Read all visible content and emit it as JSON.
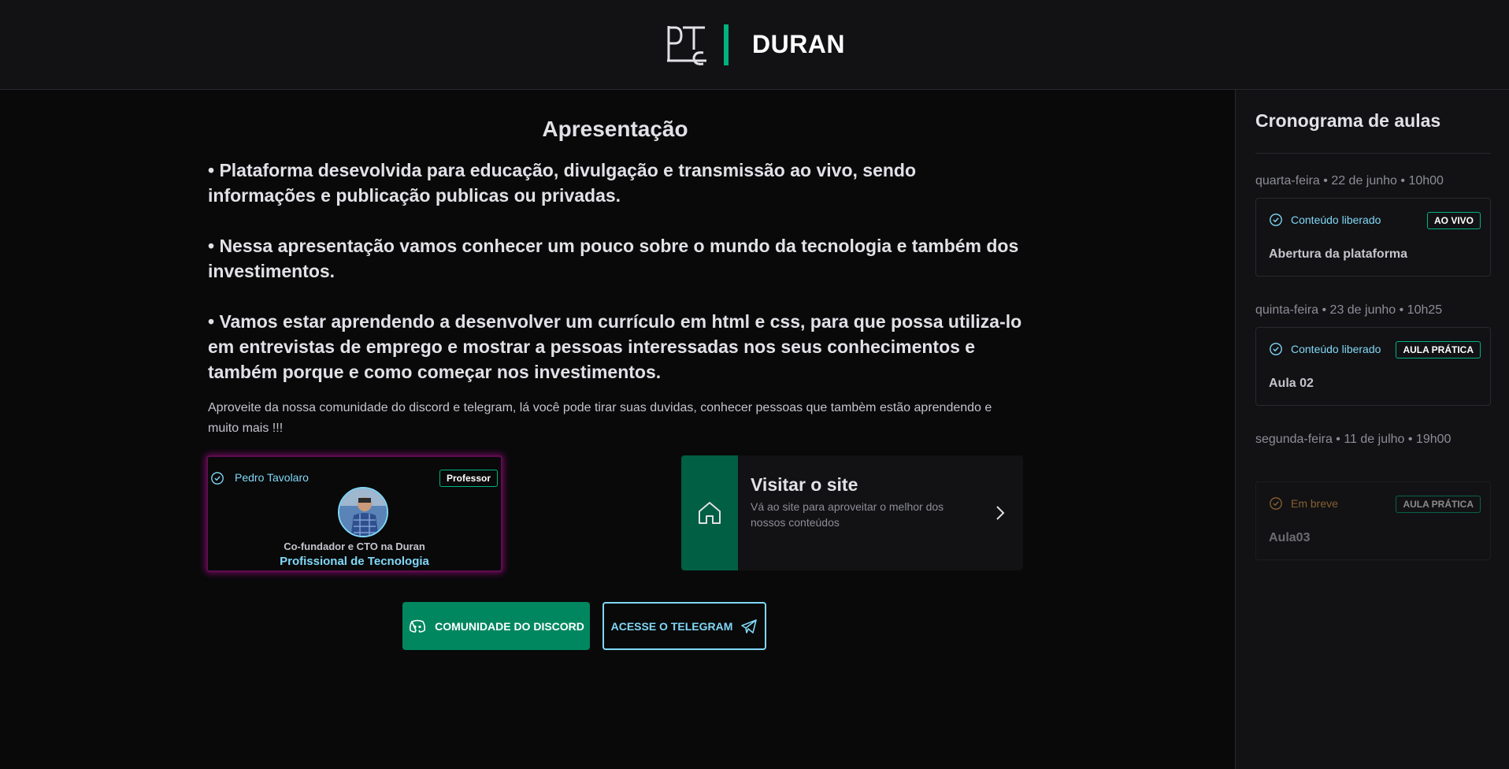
{
  "header": {
    "brand": "DURAN",
    "logo_letters": "PTC"
  },
  "main": {
    "title": "Apresentação",
    "paragraphs": [
      "• Plataforma desevolvida para educação, divulgação e transmissão ao vivo, sendo informações e publicação publicas ou privadas.",
      "• Nessa apresentação vamos conhecer um pouco sobre o mundo da tecnologia e também dos investimentos.",
      "• Vamos estar aprendendo a desenvolver um currículo em html e css, para que possa utiliza-lo em entrevistas de emprego e mostrar a pessoas interessadas nos seus conhecimentos e também porque e como começar nos investimentos."
    ],
    "note": "Aproveite da nossa comunidade do discord e telegram, lá você pode tirar suas duvidas, conhecer pessoas que tambèm estão aprendendo e muito mais !!!"
  },
  "professor": {
    "name": "Pedro Tavolaro",
    "badge": "Professor",
    "role": "Co-fundador e CTO na Duran",
    "title": "Profissional de Tecnologia"
  },
  "visit": {
    "title": "Visitar o site",
    "description": "Vá ao site para aproveitar o melhor dos nossos conteúdos"
  },
  "buttons": {
    "discord": "COMUNIDADE DO DISCORD",
    "telegram": "ACESSE O TELEGRAM"
  },
  "sidebar": {
    "title": "Cronograma de aulas",
    "lessons": [
      {
        "date": "quarta-feira • 22 de junho • 10h00",
        "status": "Conteúdo liberado",
        "badge": "AO VIVO",
        "name": "Abertura da plataforma"
      },
      {
        "date": "quinta-feira • 23 de junho • 10h25",
        "status": "Conteúdo liberado",
        "badge": "AULA PRÁTICA",
        "name": "Aula 02"
      },
      {
        "date": "segunda-feira • 11 de julho • 19h00",
        "status": "Em breve",
        "badge": "AULA PRÁTICA",
        "name": "Aula03"
      }
    ]
  },
  "colors": {
    "accent_green": "#00b37e",
    "accent_blue": "#81d8f7",
    "soon_orange": "#fba94c",
    "card_glow": "#6a0a58"
  }
}
